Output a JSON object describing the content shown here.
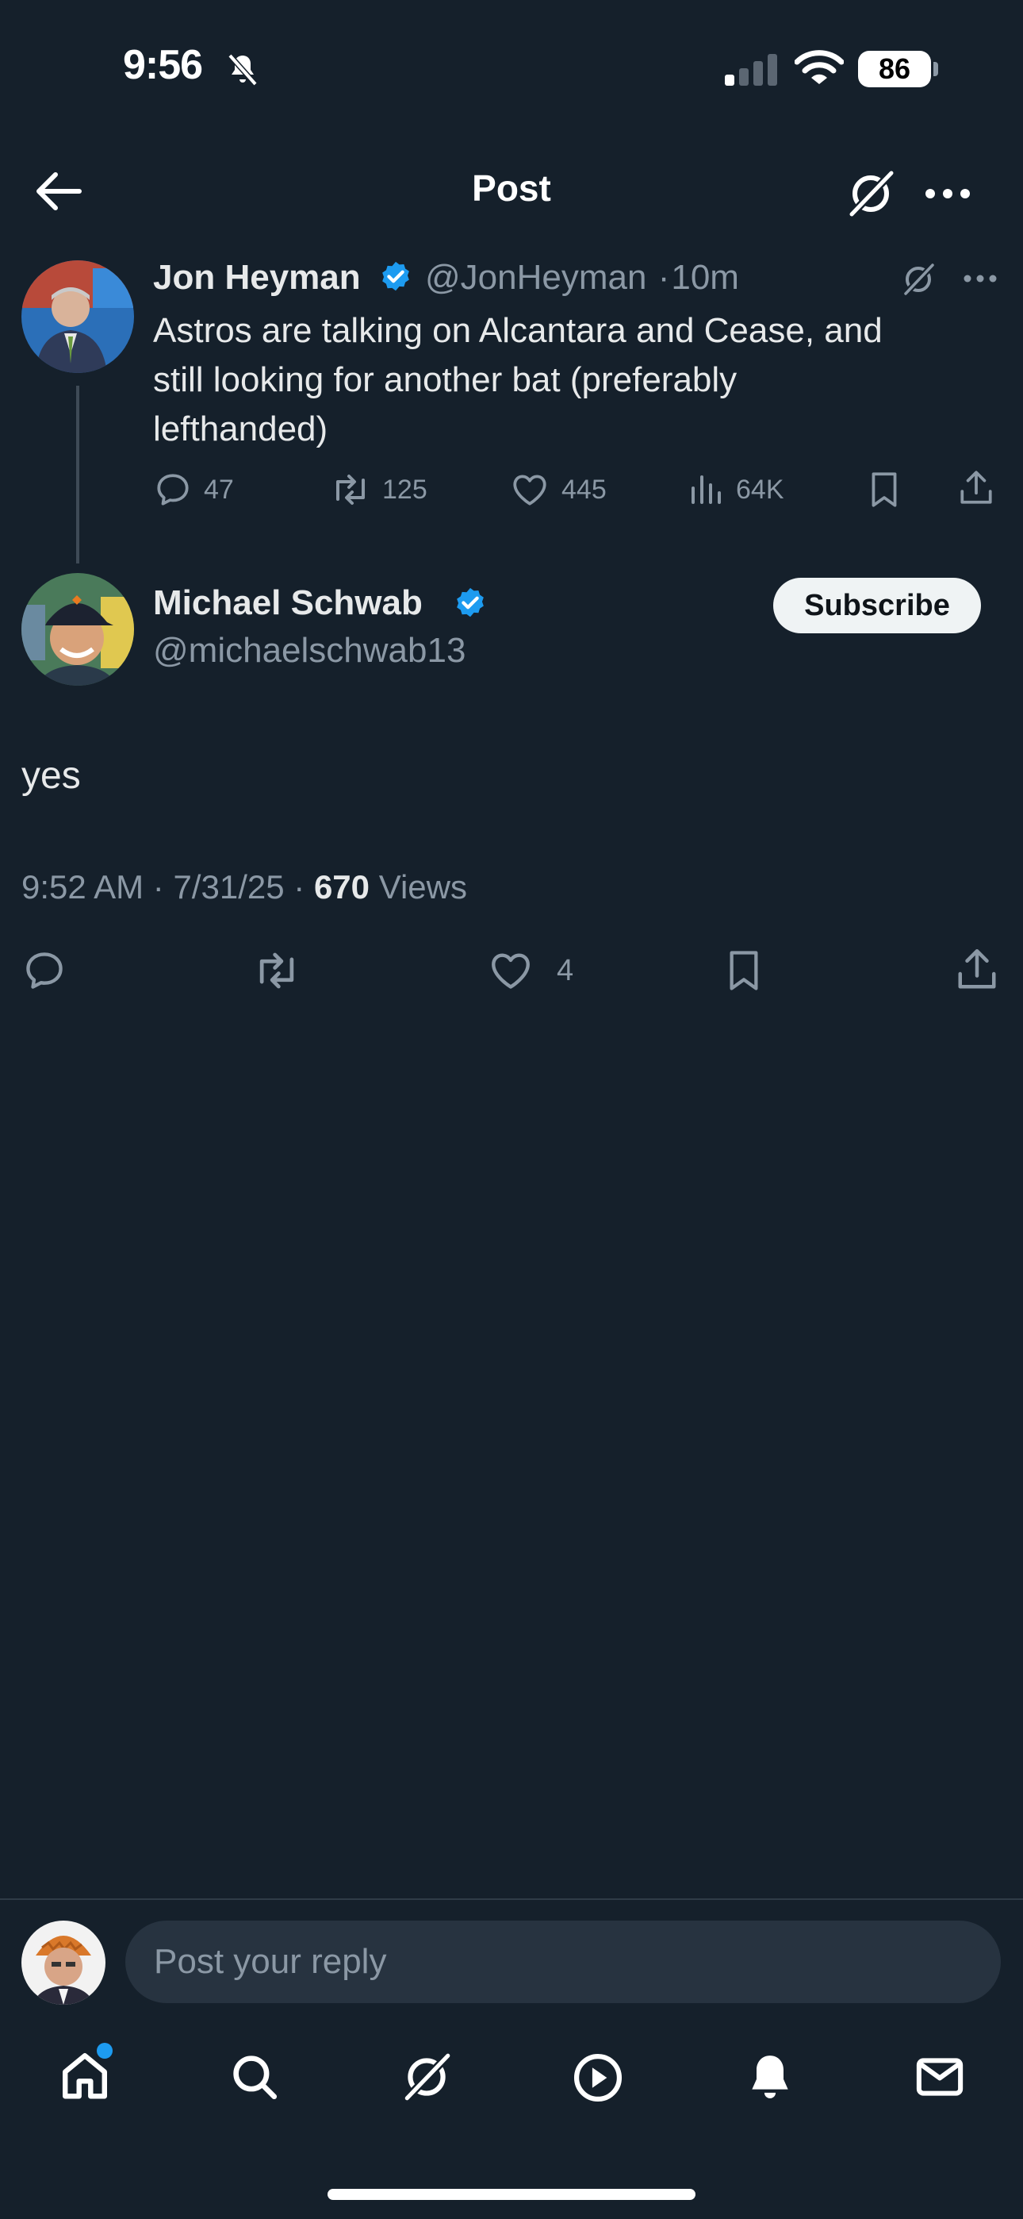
{
  "status_bar": {
    "time": "9:56",
    "battery": "86"
  },
  "header": {
    "title": "Post"
  },
  "parent_post": {
    "name": "Jon Heyman",
    "handle": "@JonHeyman",
    "separator": "·",
    "age": "10m",
    "text_lines": [
      "Astros are talking on Alcantara and Cease, and",
      "still looking for another bat (preferably",
      "lefthanded)"
    ],
    "replies": "47",
    "reposts": "125",
    "likes": "445",
    "views": "64K"
  },
  "main_post": {
    "name": "Michael Schwab",
    "handle": "@michaelschwab13",
    "subscribe_label": "Subscribe",
    "text": "yes",
    "time": "9:52 AM",
    "dot1": "·",
    "date": "7/31/25",
    "dot2": "·",
    "views_count": "670",
    "views_label": "Views",
    "likes": "4"
  },
  "reply_bar": {
    "placeholder": "Post your reply"
  },
  "colors": {
    "background": "#15202b",
    "verified": "#1d9bf0",
    "muted": "#8b98a5",
    "notification_dot": "#1d9bf0"
  }
}
